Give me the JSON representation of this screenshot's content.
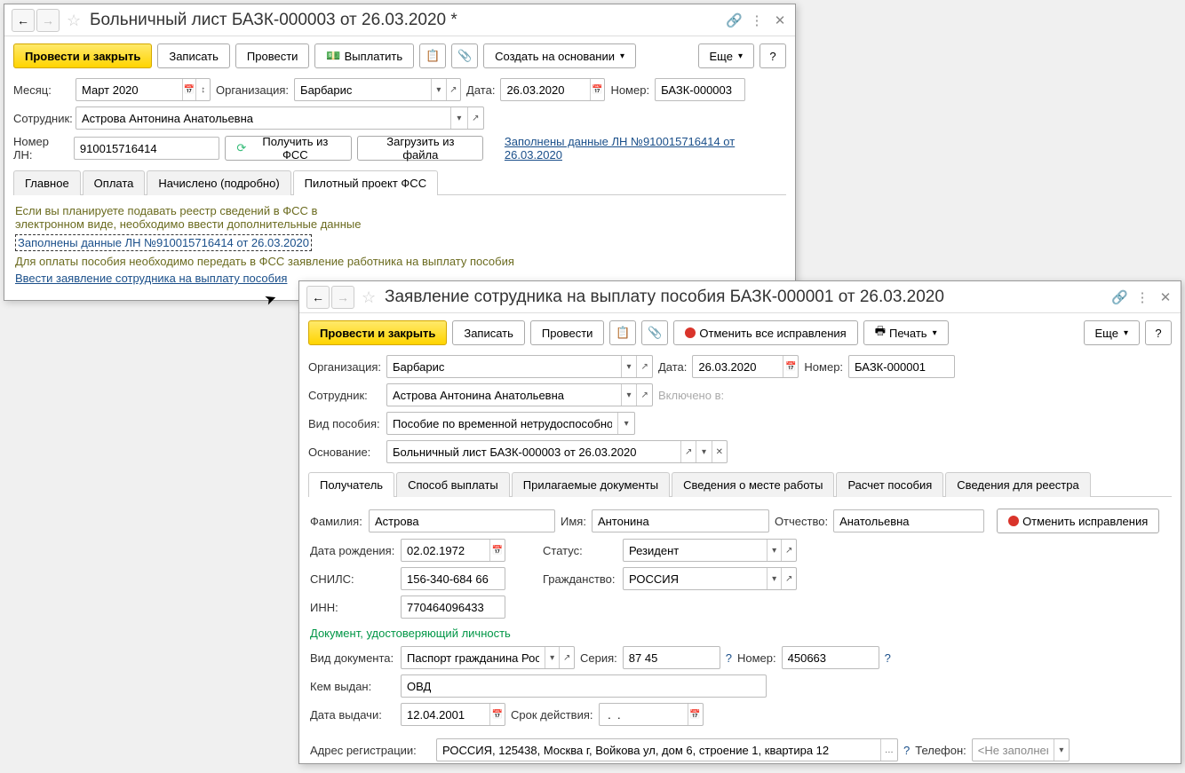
{
  "w1": {
    "title": "Больничный лист БАЗК-000003 от 26.03.2020 *",
    "toolbar": {
      "post_close": "Провести и закрыть",
      "write": "Записать",
      "post": "Провести",
      "pay": "Выплатить",
      "create_based": "Создать на основании",
      "more": "Еще"
    },
    "labels": {
      "month": "Месяц:",
      "org": "Организация:",
      "date": "Дата:",
      "number": "Номер:",
      "employee": "Сотрудник:",
      "ln": "Номер ЛН:"
    },
    "fields": {
      "month": "Март 2020",
      "org": "Барбарис",
      "date": "26.03.2020",
      "number": "БАЗК-000003",
      "employee": "Астрова Антонина Анатольевна",
      "ln": "910015716414"
    },
    "actions": {
      "get_fss": "Получить из ФСС",
      "load_file": "Загрузить из файла",
      "ln_link": "Заполнены данные ЛН №910015716414 от 26.03.2020"
    },
    "tabs": {
      "t1": "Главное",
      "t2": "Оплата",
      "t3": "Начислено (подробно)",
      "t4": "Пилотный проект ФСС"
    },
    "pane": {
      "line1": "Если вы планируете подавать реестр сведений в ФСС в",
      "line2": "электронном виде, необходимо ввести дополнительные данные",
      "link1": "Заполнены данные ЛН №910015716414 от 26.03.2020",
      "line3": "Для оплаты пособия необходимо передать в ФСС заявление работника на выплату пособия",
      "link2": "Ввести заявление сотрудника на выплату пособия"
    }
  },
  "w2": {
    "title": "Заявление сотрудника на выплату пособия БАЗК-000001 от 26.03.2020",
    "toolbar": {
      "post_close": "Провести и закрыть",
      "write": "Записать",
      "post": "Провести",
      "cancel_all": "Отменить все исправления",
      "print": "Печать",
      "more": "Еще"
    },
    "labels": {
      "org": "Организация:",
      "date": "Дата:",
      "number": "Номер:",
      "employee": "Сотрудник:",
      "included": "Включено в:",
      "benefit_type": "Вид пособия:",
      "basis": "Основание:",
      "lname": "Фамилия:",
      "fname": "Имя:",
      "mname": "Отчество:",
      "bdate": "Дата рождения:",
      "status": "Статус:",
      "snils": "СНИЛС:",
      "citizenship": "Гражданство:",
      "inn": "ИНН:",
      "doc_section": "Документ, удостоверяющий личность",
      "doc_type": "Вид документа:",
      "series": "Серия:",
      "doc_number": "Номер:",
      "issued_by": "Кем выдан:",
      "issue_date": "Дата выдачи:",
      "valid_until": "Срок действия:",
      "reg_addr": "Адрес регистрации:",
      "phone": "Телефон:",
      "cancel_fix": "Отменить исправления"
    },
    "fields": {
      "org": "Барбарис",
      "date": "26.03.2020",
      "number": "БАЗК-000001",
      "employee": "Астрова Антонина Анатольевна",
      "benefit_type": "Пособие по временной нетрудоспособности",
      "basis": "Больничный лист БАЗК-000003 от 26.03.2020",
      "lname": "Астрова",
      "fname": "Антонина",
      "mname": "Анатольевна",
      "bdate": "02.02.1972",
      "status": "Резидент",
      "snils": "156-340-684 66",
      "citizenship": "РОССИЯ",
      "inn": "770464096433",
      "doc_type": "Паспорт гражданина Росс",
      "series": "87 45",
      "doc_number": "450663",
      "issued_by": "ОВД",
      "issue_date": "12.04.2001",
      "valid_until": " .  .    ",
      "reg_addr": "РОССИЯ, 125438, Москва г, Войкова ул, дом 6, строение 1, квартира 12",
      "phone": "<Не заполнен>"
    },
    "tabs": {
      "t1": "Получатель",
      "t2": "Способ выплаты",
      "t3": "Прилагаемые документы",
      "t4": "Сведения о месте работы",
      "t5": "Расчет пособия",
      "t6": "Сведения для реестра"
    }
  }
}
